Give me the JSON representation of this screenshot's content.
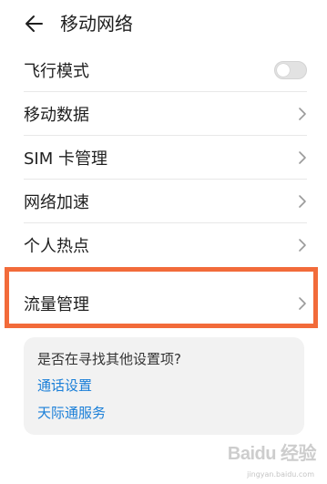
{
  "header": {
    "title": "移动网络",
    "back_icon": "back-arrow-icon"
  },
  "settings": [
    {
      "label": "飞行模式",
      "control": "toggle",
      "on": false
    },
    {
      "label": "移动数据",
      "control": "chevron"
    },
    {
      "label": "SIM 卡管理",
      "control": "chevron"
    },
    {
      "label": "网络加速",
      "control": "chevron"
    },
    {
      "label": "个人热点",
      "control": "chevron"
    },
    {
      "label": "流量管理",
      "control": "chevron",
      "highlighted": true
    }
  ],
  "suggestions": {
    "title": "是否在寻找其他设置项?",
    "links": [
      "通话设置",
      "天际通服务"
    ]
  },
  "watermark": {
    "brand": "Baidu 经验",
    "url": "jingyan.baidu.com"
  },
  "colors": {
    "highlight": "#f26b3a",
    "link": "#1a7fd8",
    "card_bg": "#f2f2f2"
  }
}
